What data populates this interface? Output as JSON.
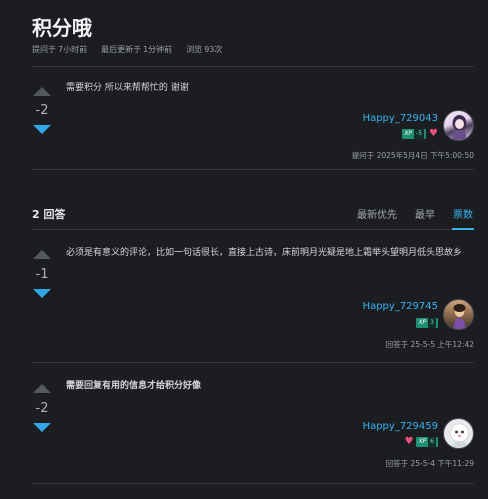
{
  "question": {
    "title": "积分哦",
    "meta": [
      {
        "label": "提问于",
        "value": "7小时前"
      },
      {
        "label": "最后更新于",
        "value": "1分钟前"
      },
      {
        "label": "浏览",
        "value": "93次"
      }
    ],
    "score": "-2",
    "body": "需要积分 所以来帮帮忙的 谢谢",
    "author": {
      "name": "Happy_729043",
      "xp": "-5",
      "xp_label": "XP"
    },
    "timestamp": "提问于 2025年5月4日 下午5:00:50"
  },
  "answers_header": {
    "count_label": "2 回答",
    "sort_tabs": [
      "最新优先",
      "最早",
      "票数"
    ],
    "active_tab": "票数"
  },
  "answers": [
    {
      "score": "-1",
      "body": "必须是有意义的评论，比如一句话很长，直接上古诗，床前明月光疑是地上霜举头望明月低头思故乡",
      "author": {
        "name": "Happy_729745",
        "xp": "3",
        "xp_label": "XP"
      },
      "timestamp": "回答于 25-5-5 上午12:42"
    },
    {
      "score": "-2",
      "body": "需要回复有用的信息才给积分好像",
      "author": {
        "name": "Happy_729459",
        "xp": "6",
        "xp_label": "XP"
      },
      "timestamp": "回答于 25-5-4 下午11:29"
    }
  ],
  "colors": {
    "accent": "#38b3f0",
    "downvote": "#2fa7e8",
    "xp_badge": "#1f8f73",
    "heart": "#e8527a",
    "background": "#1c1d20"
  },
  "icons": {
    "upvote": "triangle-up-icon",
    "downvote": "triangle-down-icon",
    "heart": "heart-icon"
  }
}
